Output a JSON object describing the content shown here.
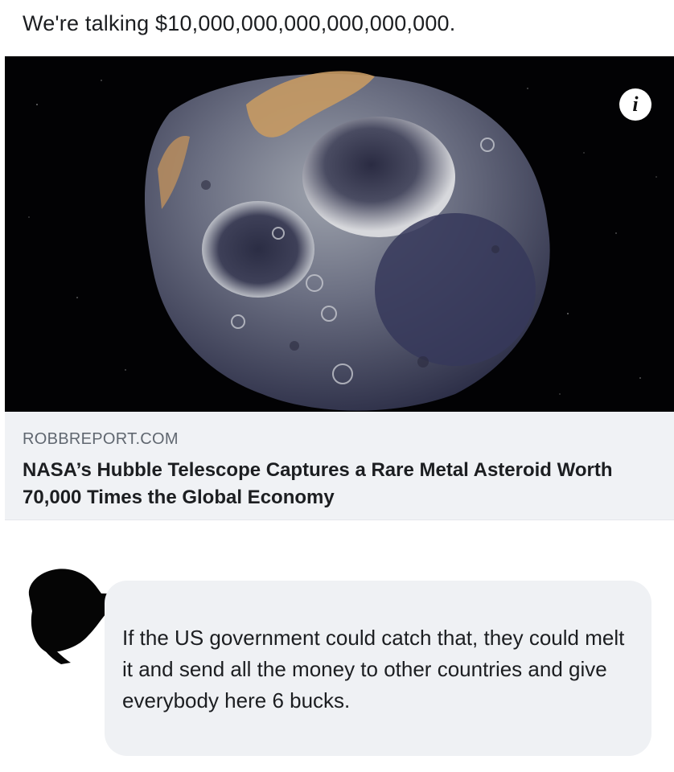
{
  "post": {
    "text": "We're talking $10,000,000,000,000,000,000."
  },
  "link_card": {
    "image_alt": "Metal asteroid illustration",
    "info_icon": "info-icon",
    "info_glyph": "i",
    "domain": "ROBBREPORT.COM",
    "title": "NASA’s Hubble Telescope Captures a Rare Metal Asteroid Worth 70,000 Times the Global Economy"
  },
  "comment": {
    "author_redacted": true,
    "text": "If the US government could catch that, they could melt it and send all the money to other countries and give everybody here 6 bucks."
  },
  "colors": {
    "background": "#ffffff",
    "card_background": "#f0f2f5",
    "bubble_background": "#eff1f4",
    "text_primary": "#1c1e21",
    "text_secondary": "#606770"
  }
}
